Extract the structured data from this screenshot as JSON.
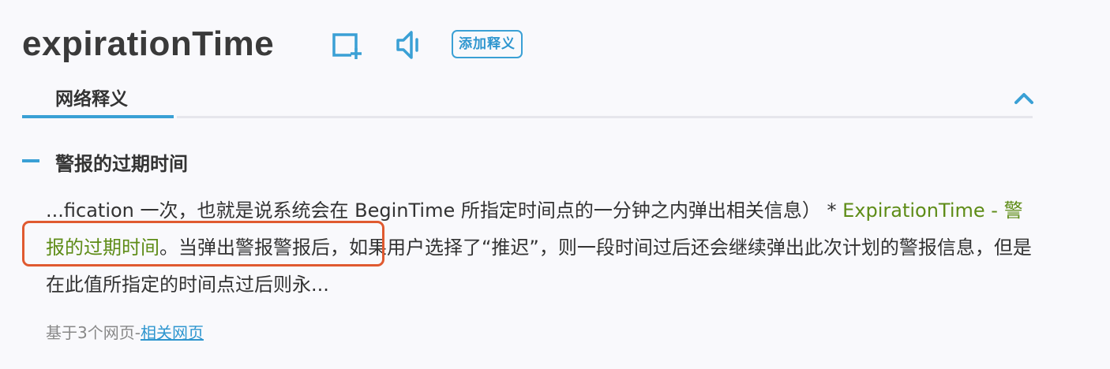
{
  "word": "expirationTime",
  "actions": {
    "add_definition_label": "添加释义"
  },
  "icons": {
    "wordbook": "add-to-wordbook-icon",
    "speaker": "speaker-icon",
    "collapse": "chevron-up-icon"
  },
  "tabs": {
    "active_label": "网络释义"
  },
  "sense": {
    "title": "警报的过期时间",
    "excerpt_before": "...fication 一次，也就是说系统会在 BeginTime 所指定时间点的一分钟之内弹出相关信息） * ",
    "highlight": "ExpirationTime - 警报的过期时间",
    "excerpt_after": "。当弹出警报警报后，如果用户选择了“推迟”，则一段时间过后还会继续弹出此次计划的警报信息，但是在此值所指定的时间点过后则永..."
  },
  "source": {
    "prefix": "基于3个网页-",
    "link_label": "相关网页"
  },
  "colors": {
    "accent": "#3aa0d5",
    "highlight_text": "#5e8c17",
    "highlight_border": "#e05a30"
  }
}
